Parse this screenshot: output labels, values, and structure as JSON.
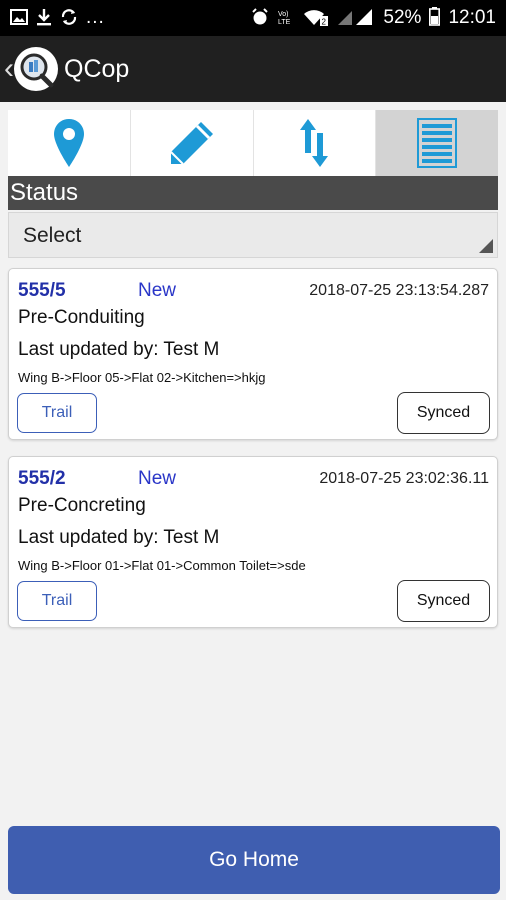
{
  "status_bar": {
    "battery": "52%",
    "time": "12:01",
    "dots": "...",
    "icons_left": [
      "image-icon",
      "download-icon",
      "sync-icon"
    ],
    "icons_right": [
      "alarm-icon",
      "volte-icon",
      "wifi-icon",
      "signal-icon",
      "battery-icon"
    ]
  },
  "app_bar": {
    "title": "QCop",
    "back_glyph": "‹"
  },
  "tabs": [
    {
      "icon": "location-pin-icon"
    },
    {
      "icon": "pencil-icon"
    },
    {
      "icon": "sync-arrows-icon"
    },
    {
      "icon": "list-icon",
      "active": true
    }
  ],
  "filter": {
    "label": "Status",
    "select_value": "Select"
  },
  "cards": [
    {
      "id": "555/5",
      "status": "New",
      "timestamp": "2018-07-25 23:13:54.287",
      "stage": "Pre-Conduiting",
      "updated_by": "Last updated by: Test M",
      "path": "Wing B->Floor 05->Flat 02->Kitchen=>hkjg",
      "trail_label": "Trail",
      "synced_label": "Synced"
    },
    {
      "id": "555/2",
      "status": "New",
      "timestamp": "2018-07-25 23:02:36.11",
      "stage": "Pre-Concreting",
      "updated_by": "Last updated by: Test M",
      "path": "Wing B->Floor 01->Flat 01->Common Toilet=>sde",
      "trail_label": "Trail",
      "synced_label": "Synced"
    }
  ],
  "footer": {
    "go_home_label": "Go Home"
  },
  "colors": {
    "accent_blue": "#3f5eb0",
    "tab_icon_blue": "#1e9ad6",
    "id_text": "#2230a8"
  }
}
